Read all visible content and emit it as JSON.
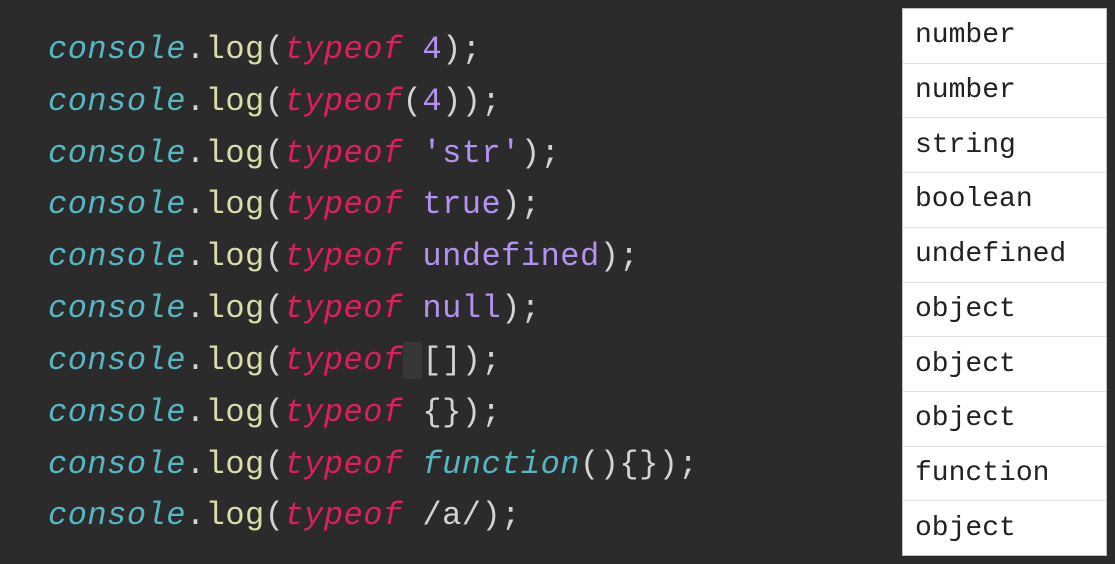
{
  "editor": {
    "lines": [
      {
        "tokens": [
          {
            "text": "console",
            "cls": "tok-console"
          },
          {
            "text": ".",
            "cls": "tok-punct"
          },
          {
            "text": "log",
            "cls": "tok-method"
          },
          {
            "text": "(",
            "cls": "tok-bracket"
          },
          {
            "text": "typeof",
            "cls": "tok-keyword"
          },
          {
            "text": " ",
            "cls": "tok-punct"
          },
          {
            "text": "4",
            "cls": "tok-number"
          },
          {
            "text": ")",
            "cls": "tok-bracket"
          },
          {
            "text": ";",
            "cls": "tok-punct"
          }
        ]
      },
      {
        "tokens": [
          {
            "text": "console",
            "cls": "tok-console"
          },
          {
            "text": ".",
            "cls": "tok-punct"
          },
          {
            "text": "log",
            "cls": "tok-method"
          },
          {
            "text": "(",
            "cls": "tok-bracket"
          },
          {
            "text": "typeof",
            "cls": "tok-keyword"
          },
          {
            "text": "(",
            "cls": "tok-bracket"
          },
          {
            "text": "4",
            "cls": "tok-number"
          },
          {
            "text": ")",
            "cls": "tok-bracket"
          },
          {
            "text": ")",
            "cls": "tok-bracket"
          },
          {
            "text": ";",
            "cls": "tok-punct"
          }
        ]
      },
      {
        "tokens": [
          {
            "text": "console",
            "cls": "tok-console"
          },
          {
            "text": ".",
            "cls": "tok-punct"
          },
          {
            "text": "log",
            "cls": "tok-method"
          },
          {
            "text": "(",
            "cls": "tok-bracket"
          },
          {
            "text": "typeof",
            "cls": "tok-keyword"
          },
          {
            "text": " ",
            "cls": "tok-punct"
          },
          {
            "text": "'str'",
            "cls": "tok-string"
          },
          {
            "text": ")",
            "cls": "tok-bracket"
          },
          {
            "text": ";",
            "cls": "tok-punct"
          }
        ]
      },
      {
        "tokens": [
          {
            "text": "console",
            "cls": "tok-console"
          },
          {
            "text": ".",
            "cls": "tok-punct"
          },
          {
            "text": "log",
            "cls": "tok-method"
          },
          {
            "text": "(",
            "cls": "tok-bracket"
          },
          {
            "text": "typeof",
            "cls": "tok-keyword"
          },
          {
            "text": " ",
            "cls": "tok-punct"
          },
          {
            "text": "true",
            "cls": "tok-value"
          },
          {
            "text": ")",
            "cls": "tok-bracket"
          },
          {
            "text": ";",
            "cls": "tok-punct"
          }
        ]
      },
      {
        "tokens": [
          {
            "text": "console",
            "cls": "tok-console"
          },
          {
            "text": ".",
            "cls": "tok-punct"
          },
          {
            "text": "log",
            "cls": "tok-method"
          },
          {
            "text": "(",
            "cls": "tok-bracket"
          },
          {
            "text": "typeof",
            "cls": "tok-keyword"
          },
          {
            "text": " ",
            "cls": "tok-punct"
          },
          {
            "text": "undefined",
            "cls": "tok-value"
          },
          {
            "text": ")",
            "cls": "tok-bracket"
          },
          {
            "text": ";",
            "cls": "tok-punct"
          }
        ]
      },
      {
        "tokens": [
          {
            "text": "console",
            "cls": "tok-console"
          },
          {
            "text": ".",
            "cls": "tok-punct"
          },
          {
            "text": "log",
            "cls": "tok-method"
          },
          {
            "text": "(",
            "cls": "tok-bracket"
          },
          {
            "text": "typeof",
            "cls": "tok-keyword"
          },
          {
            "text": " ",
            "cls": "tok-punct"
          },
          {
            "text": "null",
            "cls": "tok-value"
          },
          {
            "text": ")",
            "cls": "tok-bracket"
          },
          {
            "text": ";",
            "cls": "tok-punct"
          }
        ]
      },
      {
        "tokens": [
          {
            "text": "console",
            "cls": "tok-console"
          },
          {
            "text": ".",
            "cls": "tok-punct"
          },
          {
            "text": "log",
            "cls": "tok-method"
          },
          {
            "text": "(",
            "cls": "tok-bracket"
          },
          {
            "text": "typeof",
            "cls": "tok-keyword"
          },
          {
            "text": " ",
            "cls": "tok-punct hl"
          },
          {
            "text": "[]",
            "cls": "tok-bracket"
          },
          {
            "text": ")",
            "cls": "tok-bracket"
          },
          {
            "text": ";",
            "cls": "tok-punct"
          }
        ]
      },
      {
        "tokens": [
          {
            "text": "console",
            "cls": "tok-console"
          },
          {
            "text": ".",
            "cls": "tok-punct"
          },
          {
            "text": "log",
            "cls": "tok-method"
          },
          {
            "text": "(",
            "cls": "tok-bracket"
          },
          {
            "text": "typeof",
            "cls": "tok-keyword"
          },
          {
            "text": " ",
            "cls": "tok-punct"
          },
          {
            "text": "{}",
            "cls": "tok-bracket"
          },
          {
            "text": ")",
            "cls": "tok-bracket"
          },
          {
            "text": ";",
            "cls": "tok-punct"
          }
        ]
      },
      {
        "tokens": [
          {
            "text": "console",
            "cls": "tok-console"
          },
          {
            "text": ".",
            "cls": "tok-punct"
          },
          {
            "text": "log",
            "cls": "tok-method"
          },
          {
            "text": "(",
            "cls": "tok-bracket"
          },
          {
            "text": "typeof",
            "cls": "tok-keyword"
          },
          {
            "text": " ",
            "cls": "tok-punct"
          },
          {
            "text": "function",
            "cls": "tok-console"
          },
          {
            "text": "()",
            "cls": "tok-bracket"
          },
          {
            "text": "{}",
            "cls": "tok-bracket"
          },
          {
            "text": ")",
            "cls": "tok-bracket"
          },
          {
            "text": ";",
            "cls": "tok-punct"
          }
        ]
      },
      {
        "tokens": [
          {
            "text": "console",
            "cls": "tok-console"
          },
          {
            "text": ".",
            "cls": "tok-punct"
          },
          {
            "text": "log",
            "cls": "tok-method"
          },
          {
            "text": "(",
            "cls": "tok-bracket"
          },
          {
            "text": "typeof",
            "cls": "tok-keyword"
          },
          {
            "text": " ",
            "cls": "tok-punct"
          },
          {
            "text": "/a/",
            "cls": "tok-punct"
          },
          {
            "text": ")",
            "cls": "tok-bracket"
          },
          {
            "text": ";",
            "cls": "tok-punct"
          }
        ]
      }
    ]
  },
  "output": {
    "rows": [
      "number",
      "number",
      "string",
      "boolean",
      "undefined",
      "object",
      "object",
      "object",
      "function",
      "object"
    ]
  }
}
